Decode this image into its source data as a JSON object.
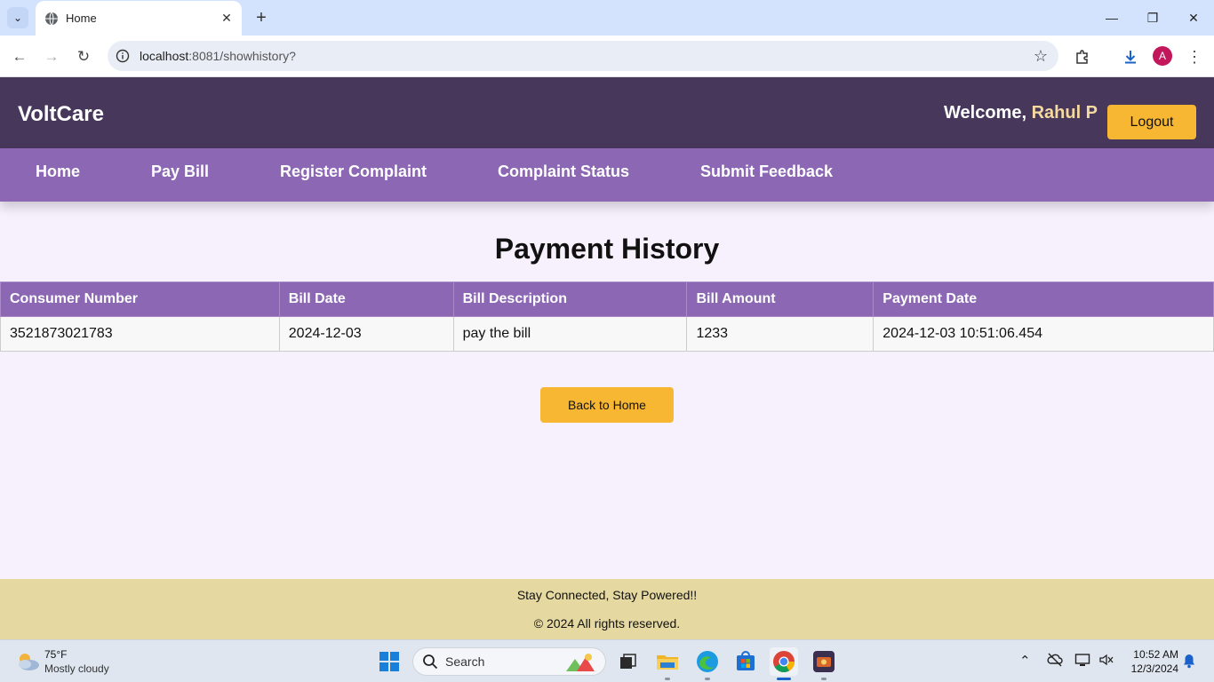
{
  "browser": {
    "tab_title": "Home",
    "url_host": "localhost",
    "url_rest": ":8081/showhistory?",
    "profile_initial": "A"
  },
  "site": {
    "brand": "VoltCare",
    "welcome_prefix": "Welcome, ",
    "user_name": "Rahul P",
    "logout_label": "Logout",
    "nav": [
      {
        "label": "Home"
      },
      {
        "label": "Pay Bill"
      },
      {
        "label": "Register Complaint"
      },
      {
        "label": "Complaint Status"
      },
      {
        "label": "Submit Feedback"
      }
    ]
  },
  "main": {
    "title": "Payment History",
    "columns": [
      "Consumer Number",
      "Bill Date",
      "Bill Description",
      "Bill Amount",
      "Payment Date"
    ],
    "rows": [
      [
        "3521873021783",
        "2024-12-03",
        "pay the bill",
        "1233",
        "2024-12-03 10:51:06.454"
      ]
    ],
    "back_label": "Back to Home"
  },
  "footer": {
    "tagline": "Stay Connected, Stay Powered!!",
    "copyright": "© 2024 All rights reserved."
  },
  "taskbar": {
    "temperature": "75°F",
    "condition": "Mostly cloudy",
    "search_placeholder": "Search",
    "time": "10:52 AM",
    "date": "12/3/2024"
  },
  "colors": {
    "header": "#47385b",
    "nav": "#8c68b4",
    "accent": "#f7b733",
    "page_bg": "#f7f0fd",
    "footer": "#e5d9a1"
  }
}
